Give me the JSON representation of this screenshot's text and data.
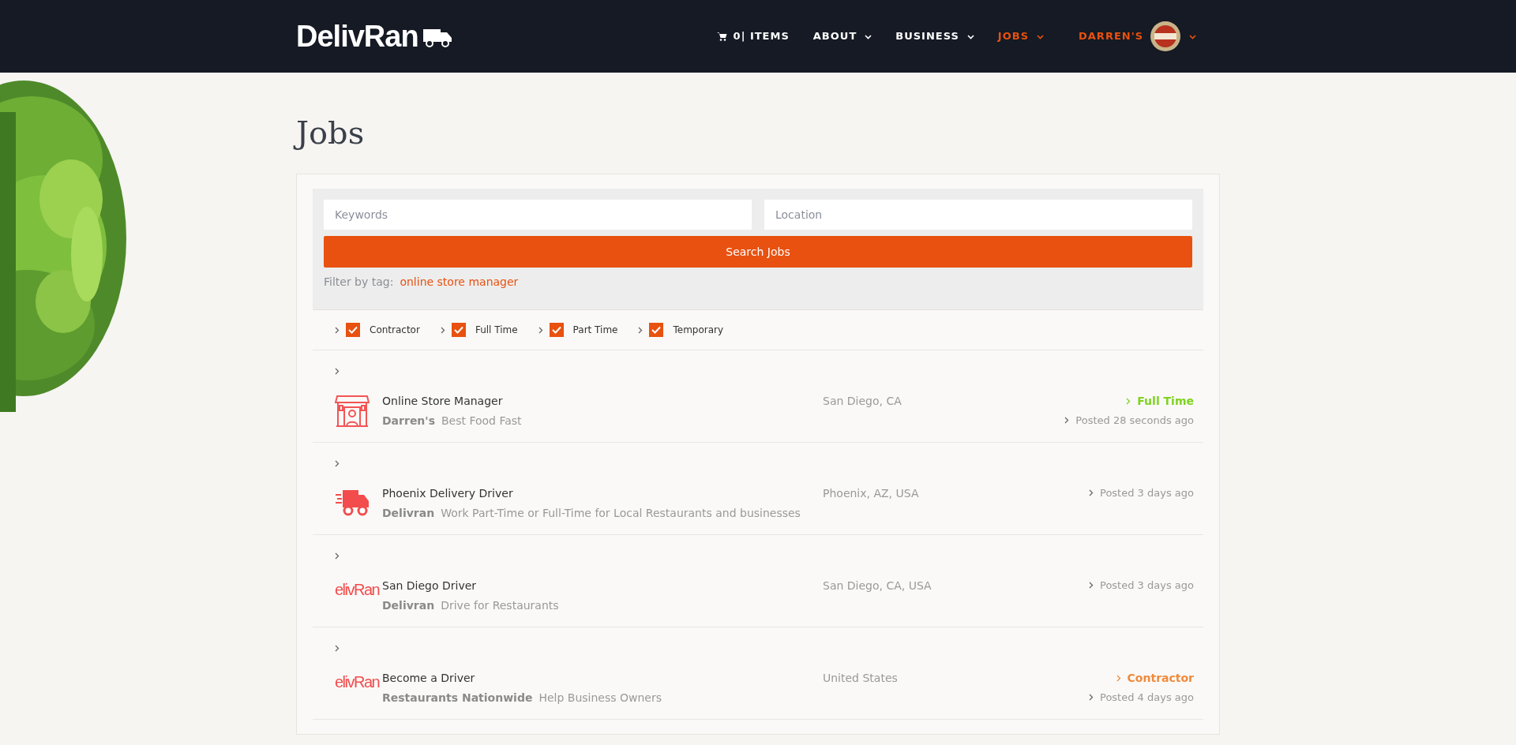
{
  "header": {
    "logo": "DelivRan",
    "nav": [
      {
        "kind": "cart",
        "label": "0| ITEMS",
        "selected": false
      },
      {
        "kind": "menu",
        "label": "ABOUT",
        "selected": false
      },
      {
        "kind": "menu",
        "label": "BUSINESS",
        "selected": false
      },
      {
        "kind": "menu",
        "label": "JOBS",
        "selected": true
      },
      {
        "kind": "account",
        "label": "DARREN'S",
        "selected": true
      }
    ]
  },
  "page_title": "Jobs",
  "search": {
    "keywords": {
      "placeholder": "Keywords"
    },
    "location": {
      "placeholder": "Location"
    },
    "button": "Search Jobs",
    "filter_label": "Filter by tag:",
    "filter_tag": "online store manager"
  },
  "job_types": [
    {
      "label": "Contractor",
      "checked": true
    },
    {
      "label": "Full Time",
      "checked": true
    },
    {
      "label": "Part Time",
      "checked": true
    },
    {
      "label": "Temporary",
      "checked": true
    }
  ],
  "jobs": [
    {
      "logo": {
        "kind": "store"
      },
      "title": "Online Store Manager",
      "company": "Darren's",
      "tagline": "Best Food Fast",
      "location": "San Diego, CA",
      "type": {
        "label": "Full Time",
        "color": "#7ed321"
      },
      "posted": "Posted 28 seconds ago"
    },
    {
      "logo": {
        "kind": "truck"
      },
      "title": "Phoenix Delivery Driver",
      "company": "Delivran",
      "tagline": "Work Part-Time or Full-Time for Local Restaurants and businesses",
      "location": "Phoenix, AZ, USA",
      "posted": "Posted 3 days ago"
    },
    {
      "logo": {
        "kind": "wordmark",
        "text": "elivRan"
      },
      "title": "San Diego Driver",
      "company": "Delivran",
      "tagline": "Drive for Restaurants",
      "location": "San Diego, CA, USA",
      "posted": "Posted 3 days ago"
    },
    {
      "logo": {
        "kind": "wordmark",
        "text": "elivRan"
      },
      "title": "Become a Driver",
      "company": "Restaurants Nationwide",
      "tagline": "Help Business Owners",
      "location": "United States",
      "type": {
        "label": "Contractor",
        "color": "#f08a3c"
      },
      "posted": "Posted 4 days ago"
    }
  ]
}
